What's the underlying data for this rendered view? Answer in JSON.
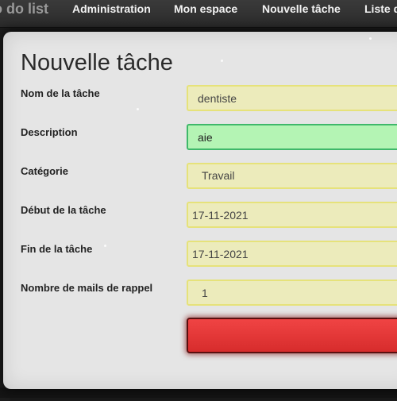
{
  "nav": {
    "brand": "o do list",
    "links": [
      {
        "label": "Administration"
      },
      {
        "label": "Mon espace"
      },
      {
        "label": "Nouvelle tâche"
      },
      {
        "label": "Liste d"
      }
    ]
  },
  "form": {
    "title": "Nouvelle tâche",
    "fields": {
      "name": {
        "label": "Nom de la tâche",
        "value": "dentiste"
      },
      "description": {
        "label": "Description",
        "value": "aie"
      },
      "category": {
        "label": "Catégorie",
        "value": "Travail"
      },
      "start": {
        "label": "Début de la tâche",
        "value": "17-11-2021"
      },
      "end": {
        "label": "Fin de la tâche",
        "value": "17-11-2021"
      },
      "reminders": {
        "label": "Nombre de mails de rappel",
        "value": "1"
      }
    },
    "submit_label": ""
  },
  "colors": {
    "input_bg": "#ecebbb",
    "input_border": "#e6e27a",
    "focus_bg": "#b4f4b4",
    "focus_border": "#3fb86a",
    "submit_bg": "#e43a3a"
  }
}
